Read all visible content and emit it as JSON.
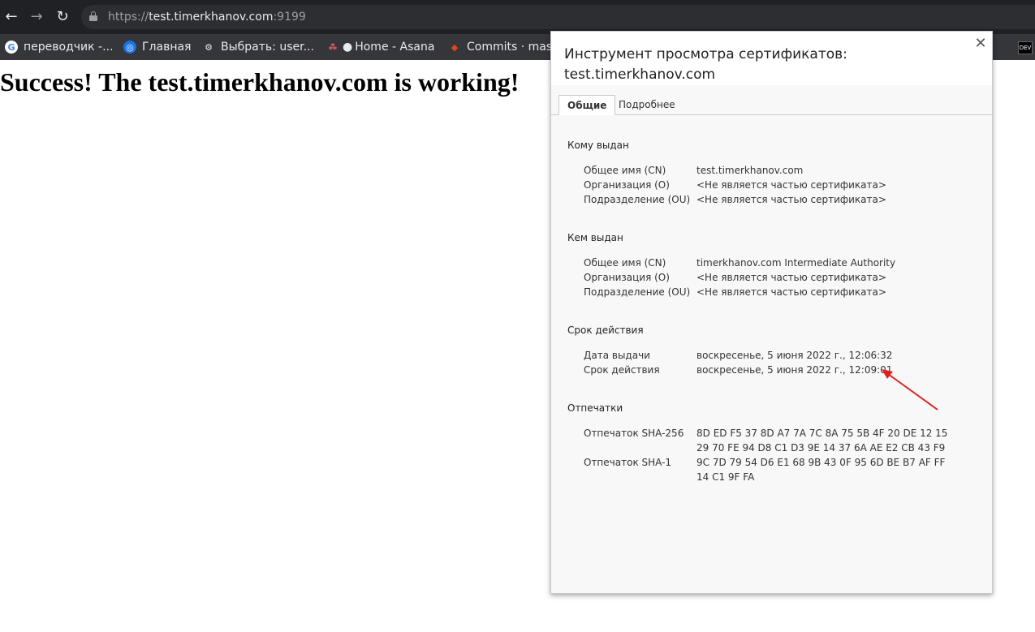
{
  "browser": {
    "url_scheme": "https://",
    "url_host": "test.timerkhanov.com",
    "url_port": ":9199"
  },
  "bookmarks": [
    {
      "label": "переводчик -...",
      "icon": "google-icon"
    },
    {
      "label": "Главная",
      "icon": "globe-icon"
    },
    {
      "label": "Выбрать: user...",
      "icon": "network-icon"
    },
    {
      "label": "Home - Asana",
      "icon": "asana-icon"
    },
    {
      "label": "Commits · mas...",
      "icon": "gitlab-icon"
    }
  ],
  "page": {
    "heading": "Success! The test.timerkhanov.com is working!"
  },
  "dialog": {
    "title": "Инструмент просмотра сертификатов: test.timerkhanov.com",
    "close_label": "✕",
    "tabs": [
      {
        "label": "Общие",
        "active": true
      },
      {
        "label": "Подробнее",
        "active": false
      }
    ],
    "issued_to": {
      "title": "Кому выдан",
      "rows": [
        {
          "label": "Общее имя (CN)",
          "value": "test.timerkhanov.com"
        },
        {
          "label": "Организация (O)",
          "value": "<Не является частью сертификата>"
        },
        {
          "label": "Подразделение (OU)",
          "value": "<Не является частью сертификата>"
        }
      ]
    },
    "issued_by": {
      "title": "Кем выдан",
      "rows": [
        {
          "label": "Общее имя (CN)",
          "value": "timerkhanov.com Intermediate Authority"
        },
        {
          "label": "Организация (O)",
          "value": "<Не является частью сертификата>"
        },
        {
          "label": "Подразделение (OU)",
          "value": "<Не является частью сертификата>"
        }
      ]
    },
    "validity": {
      "title": "Срок действия",
      "rows": [
        {
          "label": "Дата выдачи",
          "value": "воскресенье, 5 июня 2022 г., 12:06:32"
        },
        {
          "label": "Срок действия",
          "value": "воскресенье, 5 июня 2022 г., 12:09:01"
        }
      ]
    },
    "fingerprints": {
      "title": "Отпечатки",
      "sha256_label": "Отпечаток SHA-256",
      "sha256_line1": "8D ED F5 37 8D A7 7A 7C 8A 75 5B 4F 20 DE 12 15",
      "sha256_line2": "29 70 FE 94 D8 C1 D3 9E 14 37 6A AE E2 CB 43 F9",
      "sha1_label": "Отпечаток SHA-1",
      "sha1_line1": "9C 7D 79 54 D6 E1 68 9B 43 0F 95 6D BE B7 AF FF",
      "sha1_line2": "14 C1 9F FA"
    }
  },
  "annotation_color": "#e02020"
}
